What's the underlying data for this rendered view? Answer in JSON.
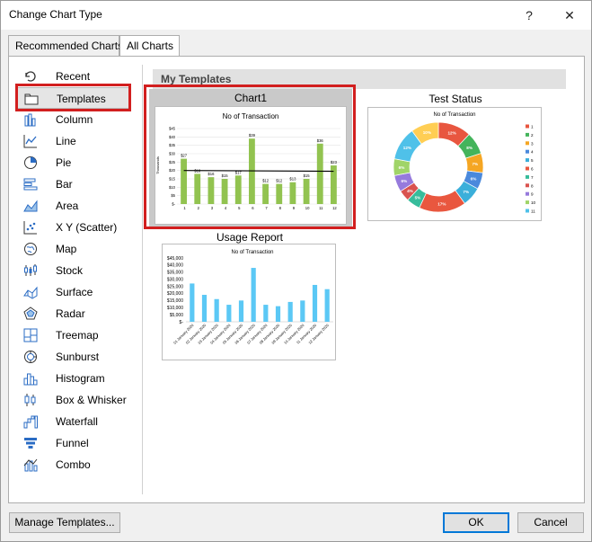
{
  "window": {
    "title": "Change Chart Type",
    "help_glyph": "?",
    "close_glyph": "✕"
  },
  "tabs": [
    {
      "label": "Recommended Charts",
      "active": false
    },
    {
      "label": "All Charts",
      "active": true
    }
  ],
  "sidebar": {
    "items": [
      {
        "label": "Recent",
        "icon": "recent-icon"
      },
      {
        "label": "Templates",
        "icon": "folder-icon",
        "selected": true
      },
      {
        "label": "Column",
        "icon": "column-chart-icon"
      },
      {
        "label": "Line",
        "icon": "line-chart-icon"
      },
      {
        "label": "Pie",
        "icon": "pie-chart-icon"
      },
      {
        "label": "Bar",
        "icon": "bar-chart-icon"
      },
      {
        "label": "Area",
        "icon": "area-chart-icon"
      },
      {
        "label": "X Y (Scatter)",
        "icon": "scatter-chart-icon"
      },
      {
        "label": "Map",
        "icon": "map-chart-icon"
      },
      {
        "label": "Stock",
        "icon": "stock-chart-icon"
      },
      {
        "label": "Surface",
        "icon": "surface-chart-icon"
      },
      {
        "label": "Radar",
        "icon": "radar-chart-icon"
      },
      {
        "label": "Treemap",
        "icon": "treemap-chart-icon"
      },
      {
        "label": "Sunburst",
        "icon": "sunburst-chart-icon"
      },
      {
        "label": "Histogram",
        "icon": "histogram-chart-icon"
      },
      {
        "label": "Box & Whisker",
        "icon": "box-whisker-chart-icon"
      },
      {
        "label": "Waterfall",
        "icon": "waterfall-chart-icon"
      },
      {
        "label": "Funnel",
        "icon": "funnel-chart-icon"
      },
      {
        "label": "Combo",
        "icon": "combo-chart-icon"
      }
    ]
  },
  "main": {
    "section_title": "My Templates",
    "templates": [
      {
        "name": "Chart1",
        "selected": true
      },
      {
        "name": "Test Status",
        "selected": false
      },
      {
        "name": "Usage Report",
        "selected": false
      }
    ]
  },
  "chart_data": [
    {
      "type": "bar",
      "title": "No of Transaction",
      "ylabel": "Thousands",
      "categories": [
        "1",
        "2",
        "3",
        "4",
        "5",
        "6",
        "7",
        "8",
        "9",
        "10",
        "11",
        "12"
      ],
      "y_ticks": [
        "$45",
        "$40",
        "$35",
        "$30",
        "$25",
        "$20",
        "$15",
        "$10",
        "$5",
        "$-"
      ],
      "ylim": [
        0,
        45
      ],
      "values": [
        27,
        18,
        16,
        15,
        17,
        39,
        12,
        12,
        13,
        15,
        36,
        23
      ],
      "data_labels": [
        "$27",
        "$18",
        "$16",
        "$15",
        "$17",
        "$39",
        "$12",
        "$12",
        "$13",
        "$15",
        "$36",
        "$23"
      ],
      "trendline": [
        20,
        19.5
      ],
      "bar_color": "#92c350",
      "line_color": "#000000"
    },
    {
      "type": "pie",
      "donut": true,
      "title": "No of Transaction",
      "legend": [
        "1",
        "2",
        "3",
        "4",
        "5",
        "6",
        "7",
        "8",
        "9",
        "10",
        "11"
      ],
      "slice_labels": [
        "12%",
        "8%",
        "7%",
        "6%",
        "7%",
        "17%",
        "5%",
        "4%",
        "6%",
        "6%",
        "12%",
        "10%"
      ],
      "values": [
        12,
        8,
        7,
        6,
        7,
        17,
        5,
        4,
        6,
        6,
        12,
        10
      ],
      "colors": [
        "#e8563f",
        "#44b45b",
        "#f5a623",
        "#4a89dc",
        "#3bafda",
        "#e9573f",
        "#37bc9b",
        "#d9534f",
        "#967adc",
        "#a0d468",
        "#4fc1e9",
        "#ffce54"
      ],
      "legend_position": "right"
    },
    {
      "type": "bar",
      "title": "No of Transaction",
      "categories": [
        "01 January 2020",
        "02 January 2020",
        "03 January 2020",
        "04 January 2020",
        "05 January 2020",
        "06 January 2020",
        "07 January 2020",
        "08 January 2020",
        "09 January 2020",
        "10 January 2020",
        "11 January 2020",
        "12 January 2020"
      ],
      "y_ticks": [
        "$45,000",
        "$40,000",
        "$35,000",
        "$30,000",
        "$25,000",
        "$20,000",
        "$15,000",
        "$10,000",
        "$5,000",
        "$-"
      ],
      "ylim": [
        0,
        45000
      ],
      "values": [
        27000,
        19000,
        16000,
        12000,
        15000,
        38000,
        12000,
        11000,
        14000,
        15000,
        26000,
        23000
      ],
      "bar_color": "#5bc8f5"
    }
  ],
  "footer": {
    "manage_label": "Manage Templates...",
    "ok_label": "OK",
    "cancel_label": "Cancel"
  }
}
